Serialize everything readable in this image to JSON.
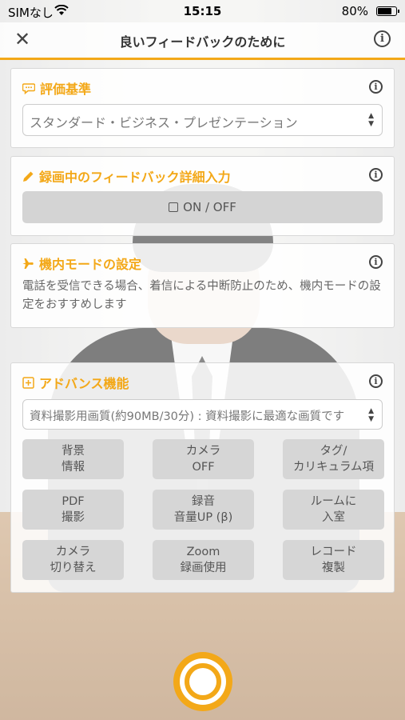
{
  "status_bar": {
    "carrier": "SIMなし",
    "time": "15:15",
    "battery": "80%",
    "battery_level": 0.8
  },
  "nav": {
    "close": "✕",
    "title": "良いフィードバックのために",
    "info": "i"
  },
  "evaluation": {
    "title": "評価基準",
    "icon": "speech-bubble-icon",
    "selected": "スタンダード・ビジネス・プレゼンテーション"
  },
  "recording_feedback": {
    "title": "録画中のフィードバック詳細入力",
    "icon": "pencil-icon",
    "toggle_label": "ON / OFF"
  },
  "airplane_mode": {
    "title": "機内モードの設定",
    "icon": "airplane-icon",
    "description": "電話を受信できる場合、着信による中断防止のため、機内モードの設定をおすすめします"
  },
  "advanced": {
    "title": "アドバンス機能",
    "icon": "plus-square-icon",
    "selected": "資料撮影用画質(約90MB/30分) : 資料撮影に最適な画質です",
    "buttons": [
      {
        "line1": "背景",
        "line2": "情報"
      },
      {
        "line1": "カメラ",
        "line2": "OFF"
      },
      {
        "line1": "タグ/",
        "line2": "カリキュラム項"
      },
      {
        "line1": "PDF",
        "line2": "撮影"
      },
      {
        "line1": "録音",
        "line2": "音量UP (β)"
      },
      {
        "line1": "ルームに",
        "line2": "入室"
      },
      {
        "line1": "カメラ",
        "line2": "切り替え"
      },
      {
        "line1": "Zoom",
        "line2": "録画使用"
      },
      {
        "line1": "レコード",
        "line2": "複製"
      }
    ]
  },
  "colors": {
    "accent": "#f3a818"
  }
}
